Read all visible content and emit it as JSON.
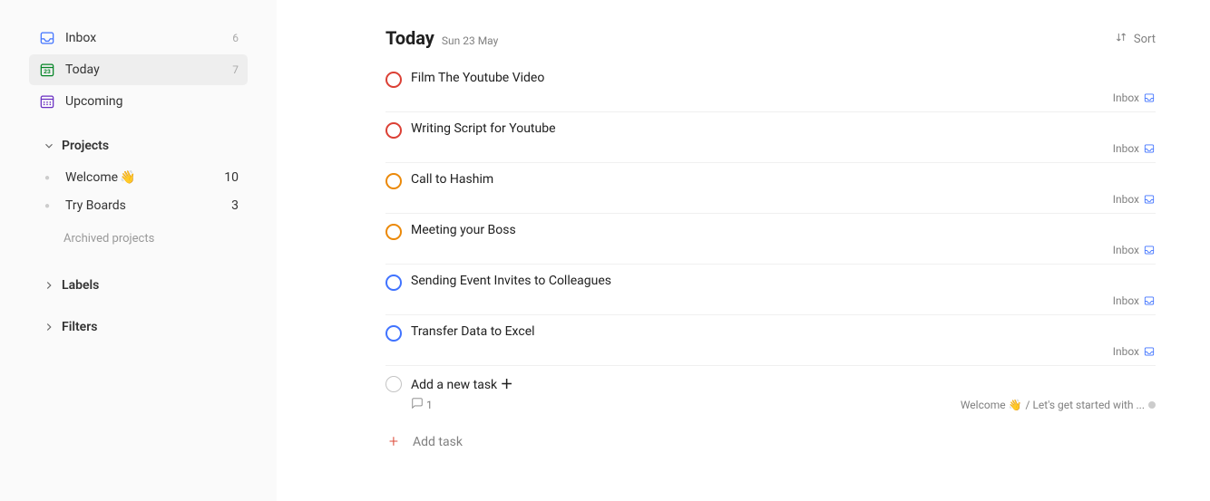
{
  "sidebar": {
    "inbox": {
      "label": "Inbox",
      "count": "6"
    },
    "today": {
      "label": "Today",
      "count": "7"
    },
    "upcoming": {
      "label": "Upcoming"
    },
    "projects_header": "Projects",
    "projects": [
      {
        "label": "Welcome",
        "emoji": "👋",
        "count": "10"
      },
      {
        "label": "Try Boards",
        "count": "3"
      }
    ],
    "archived_label": "Archived projects",
    "labels_header": "Labels",
    "filters_header": "Filters"
  },
  "main": {
    "title": "Today",
    "date": "Sun 23 May",
    "sort_label": "Sort",
    "tasks": [
      {
        "title": "Film The Youtube Video",
        "priority": "red",
        "project": "Inbox",
        "project_type": "inbox"
      },
      {
        "title": "Writing Script for Youtube",
        "priority": "red",
        "project": "Inbox",
        "project_type": "inbox"
      },
      {
        "title": "Call to Hashim",
        "priority": "orange",
        "project": "Inbox",
        "project_type": "inbox"
      },
      {
        "title": "Meeting your Boss",
        "priority": "orange",
        "project": "Inbox",
        "project_type": "inbox"
      },
      {
        "title": "Sending Event Invites to Colleagues",
        "priority": "blue",
        "project": "Inbox",
        "project_type": "inbox"
      },
      {
        "title": "Transfer Data to Excel",
        "priority": "blue",
        "project": "Inbox",
        "project_type": "inbox"
      },
      {
        "title": "Add a new task",
        "priority": "grey",
        "plus": true,
        "comments": "1",
        "project": "Welcome 👋",
        "project_path": " / Let's get started with ... ",
        "project_type": "grey"
      }
    ],
    "add_task_label": "Add task"
  }
}
